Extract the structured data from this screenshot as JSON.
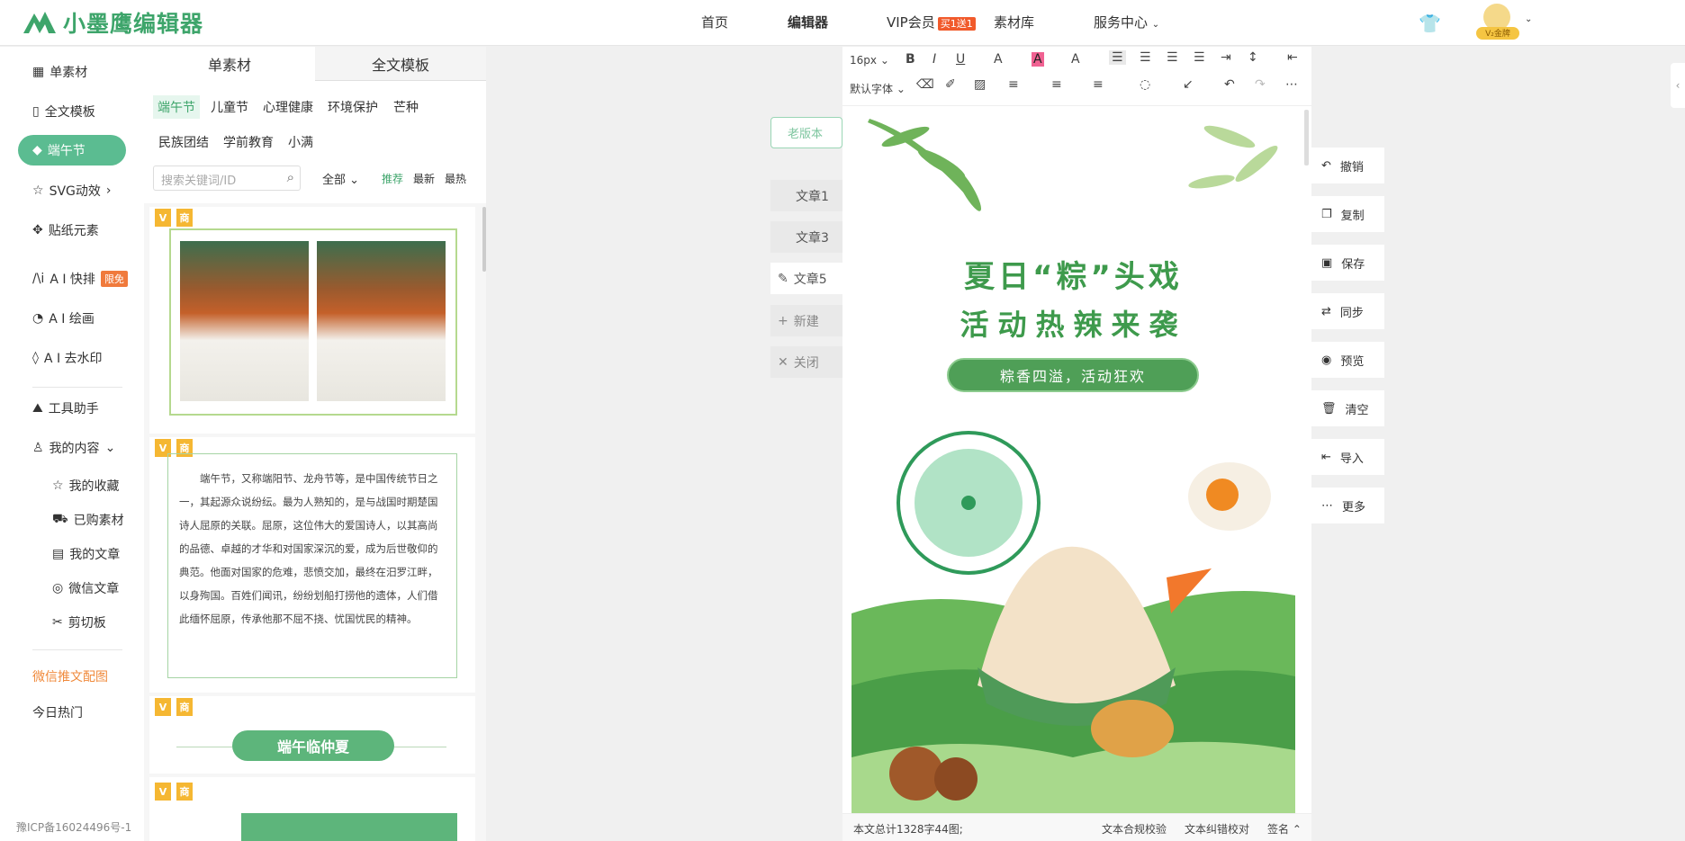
{
  "header": {
    "logo": "小墨鹰编辑器",
    "nav": [
      "首页",
      "编辑器",
      "VIP会员",
      "素材库",
      "服务中心"
    ],
    "vip_badge": "买1送1",
    "avatar_badge": "V₂金牌"
  },
  "sidebar": {
    "items": [
      "单素材",
      "全文模板",
      "端午节",
      "SVG动效",
      "贴纸元素",
      "A I 快排",
      "A I 绘画",
      "A I 去水印",
      "工具助手",
      "我的内容"
    ],
    "ai_badge": "限免",
    "sub_items": [
      "我的收藏",
      "已购素材",
      "我的文章",
      "微信文章",
      "剪切板"
    ],
    "links": [
      "微信推文配图",
      "今日热门"
    ],
    "icp": "豫ICP备16024496号-1"
  },
  "panel": {
    "tabs": [
      "单素材",
      "全文模板"
    ],
    "categories": [
      "端午节",
      "儿童节",
      "心理健康",
      "环境保护",
      "芒种",
      "民族团结",
      "学前教育",
      "小满"
    ],
    "search_placeholder": "搜索关键词/ID",
    "filter_all": "全部",
    "sort": [
      "推荐",
      "最新",
      "最热"
    ],
    "badge_v": "V",
    "badge_shang": "商",
    "card_text": "端午节，又称端阳节、龙舟节等，是中国传统节日之一，其起源众说纷纭。最为人熟知的，是与战国时期楚国诗人屈原的关联。屈原，这位伟大的爱国诗人，以其高尚的品德、卓越的才华和对国家深沉的爱，成为后世敬仰的典范。他面对国家的危难，悲愤交加，最终在汨罗江畔，以身殉国。百姓们闻讯，纷纷划船打捞他的遗体，人们借此缅怀屈原，传承他那不屈不挠、忧国忧民的精神。",
    "banner_title": "端午临仲夏"
  },
  "center": {
    "old_version": "老版本",
    "articles": [
      "文章1",
      "文章3",
      "文章5"
    ],
    "new": "新建",
    "close": "关闭"
  },
  "editor": {
    "font_size": "16px",
    "font_family": "默认字体",
    "title_line1": "夏日“粽”头戏",
    "title_line2": "活动热辣来袭",
    "subtitle": "粽香四溢，活动狂欢",
    "status_left": "本文总计1328字44图;",
    "status_right": [
      "文本合规校验",
      "文本纠错校对",
      "签名"
    ]
  },
  "actions": [
    "撤销",
    "复制",
    "保存",
    "同步",
    "预览",
    "清空",
    "导入",
    "更多"
  ],
  "colors": {
    "brand": "#3ea56b",
    "accent": "#5bbc91",
    "vip": "#f15a2b"
  }
}
